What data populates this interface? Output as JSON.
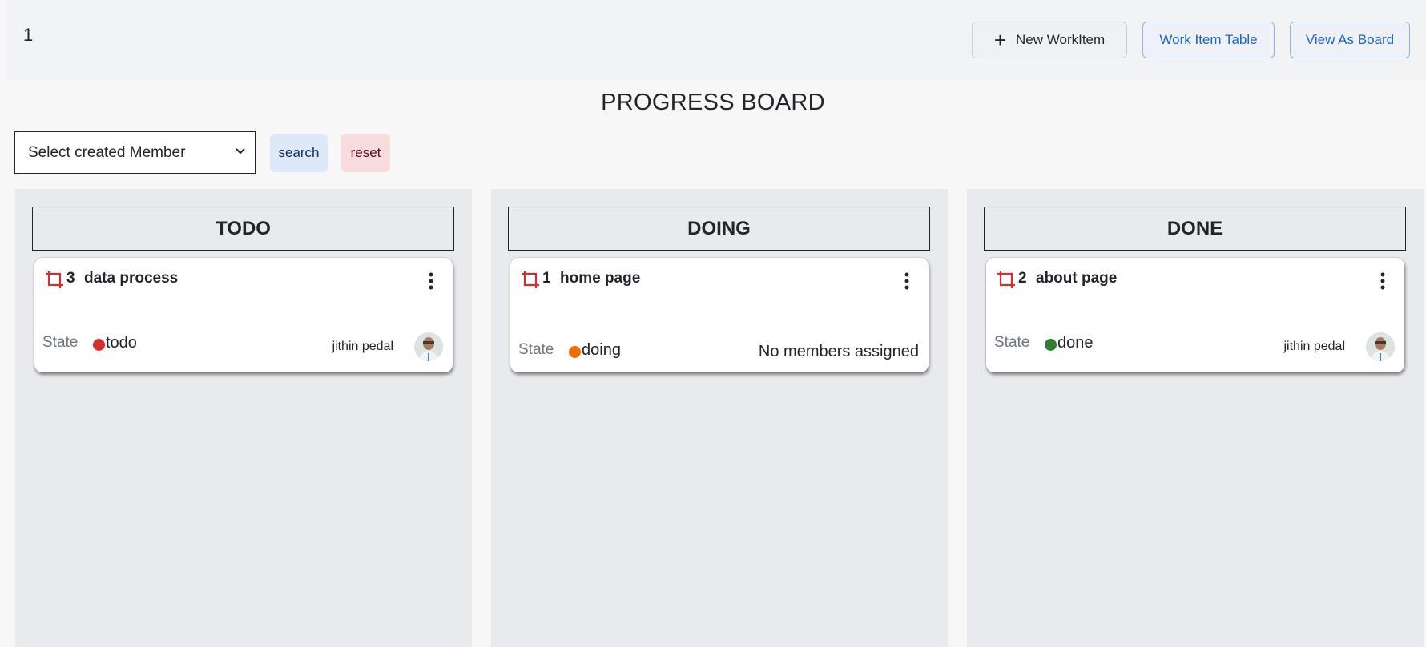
{
  "header": {
    "page_number": "1",
    "new_workitem_label": "New WorkItem",
    "work_item_table_label": "Work Item Table",
    "view_as_board_label": "View As Board"
  },
  "board": {
    "title": "PROGRESS BOARD"
  },
  "filter": {
    "member_select_value": "Select created Member",
    "search_label": "search",
    "reset_label": "reset"
  },
  "columns": [
    {
      "title": "TODO",
      "cards": [
        {
          "id": "3",
          "title": "data process",
          "state_label": "State",
          "state": "todo",
          "state_color": "#d32f2f",
          "assignee": "jithin pedal"
        }
      ]
    },
    {
      "title": "DOING",
      "cards": [
        {
          "id": "1",
          "title": "home page",
          "state_label": "State",
          "state": "doing",
          "state_color": "#ef6c00",
          "assignee_text": "No members assigned"
        }
      ]
    },
    {
      "title": "DONE",
      "cards": [
        {
          "id": "2",
          "title": "about page",
          "state_label": "State",
          "state": "done",
          "state_color": "#2e7d32",
          "assignee": "jithin pedal"
        }
      ]
    }
  ],
  "colors": {
    "accent_blue": "#1a64c8",
    "crop_icon_red": "#d32f2f"
  }
}
